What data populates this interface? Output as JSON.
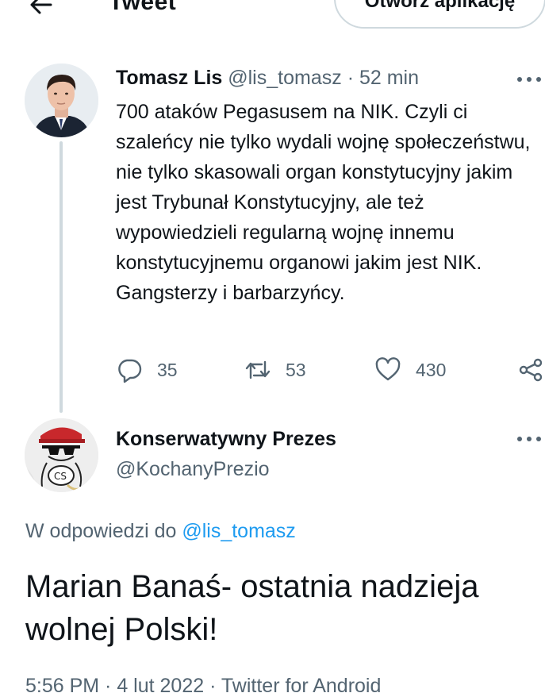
{
  "header": {
    "title": "Tweet",
    "open_app_label": "Otwórz aplikację"
  },
  "tweet": {
    "name": "Tomasz Lis",
    "handle": "@lis_tomasz",
    "separator": "·",
    "time": "52 min",
    "text": "700 ataków Pegasusem na NIK. Czyli ci szaleńcy nie tylko wydali wojnę społeczeństwu, nie tylko skasowali organ konstytucyjny jakim jest Trybunał Konstytucyjny, ale  też wypowiedzieli regularną wojnę innemu konstytucyjnemu organowi jakim jest NIK. Gangsterzy i barbarzyńcy.",
    "replies": "35",
    "retweets": "53",
    "likes": "430"
  },
  "reply": {
    "name": "Konserwatywny Prezes",
    "handle": "@KochanyPrezio",
    "replying_prefix": "W odpowiedzi do ",
    "replying_to": "@lis_tomasz",
    "text": "Marian Banaś- ostatnia nadzieja wolnej Polski!",
    "timestamp": "5:56 PM · 4 lut 2022 · Twitter for Android"
  },
  "icons": {
    "back": "back-arrow-icon",
    "more": "more-options-icon",
    "reply": "reply-icon",
    "retweet": "retweet-icon",
    "like": "heart-icon",
    "share": "share-icon"
  },
  "colors": {
    "text": "#0f1419",
    "secondary": "#536471",
    "link": "#1d9bf0",
    "border": "#cfd9de"
  }
}
